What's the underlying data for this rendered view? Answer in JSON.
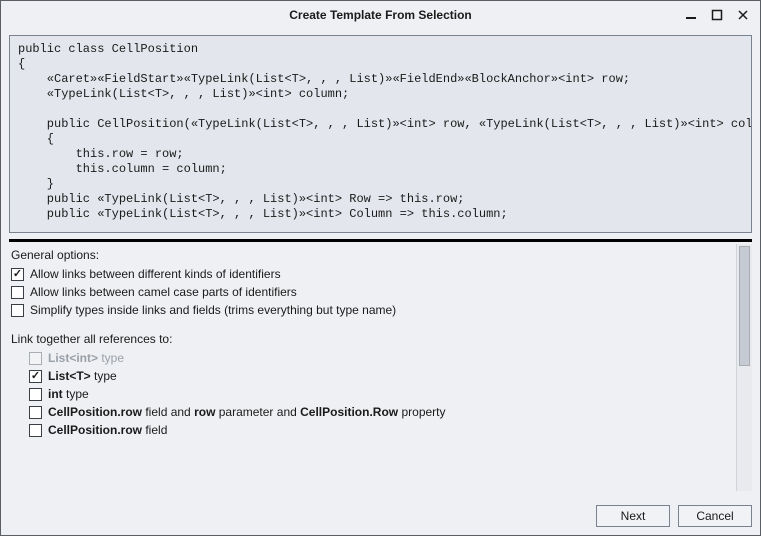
{
  "window": {
    "title": "Create Template From Selection"
  },
  "code": "public class CellPosition\n{\n    «Caret»«FieldStart»«TypeLink(List<T>, , , List)»«FieldEnd»«BlockAnchor»<int> row;\n    «TypeLink(List<T>, , , List)»<int> column;\n\n    public CellPosition(«TypeLink(List<T>, , , List)»<int> row, «TypeLink(List<T>, , , List)»<int> column)\n    {\n        this.row = row;\n        this.column = column;\n    }\n    public «TypeLink(List<T>, , , List)»<int> Row => this.row;\n    public «TypeLink(List<T>, , , List)»<int> Column => this.column;\n\n}«FinalTarget»",
  "general": {
    "heading": "General options:",
    "allow_kinds": "Allow links between different kinds of identifiers",
    "allow_camel": "Allow links between camel case parts of identifiers",
    "simplify": "Simplify types inside links and fields (trims everything but type name)"
  },
  "link": {
    "heading": "Link together all references to:",
    "listint_bold": "List<int>",
    "listint_suffix": " type",
    "listt_bold": "List<T>",
    "listt_suffix": " type",
    "int_bold": "int",
    "int_suffix": " type",
    "row_bold1": "CellPosition.row",
    "row_mid1": " field and ",
    "row_bold2": "row",
    "row_mid2": " parameter and ",
    "row_bold3": "CellPosition.Row",
    "row_suffix": " property",
    "row2_bold": "CellPosition.row",
    "row2_suffix": " field"
  },
  "buttons": {
    "next": "Next",
    "cancel": "Cancel"
  }
}
